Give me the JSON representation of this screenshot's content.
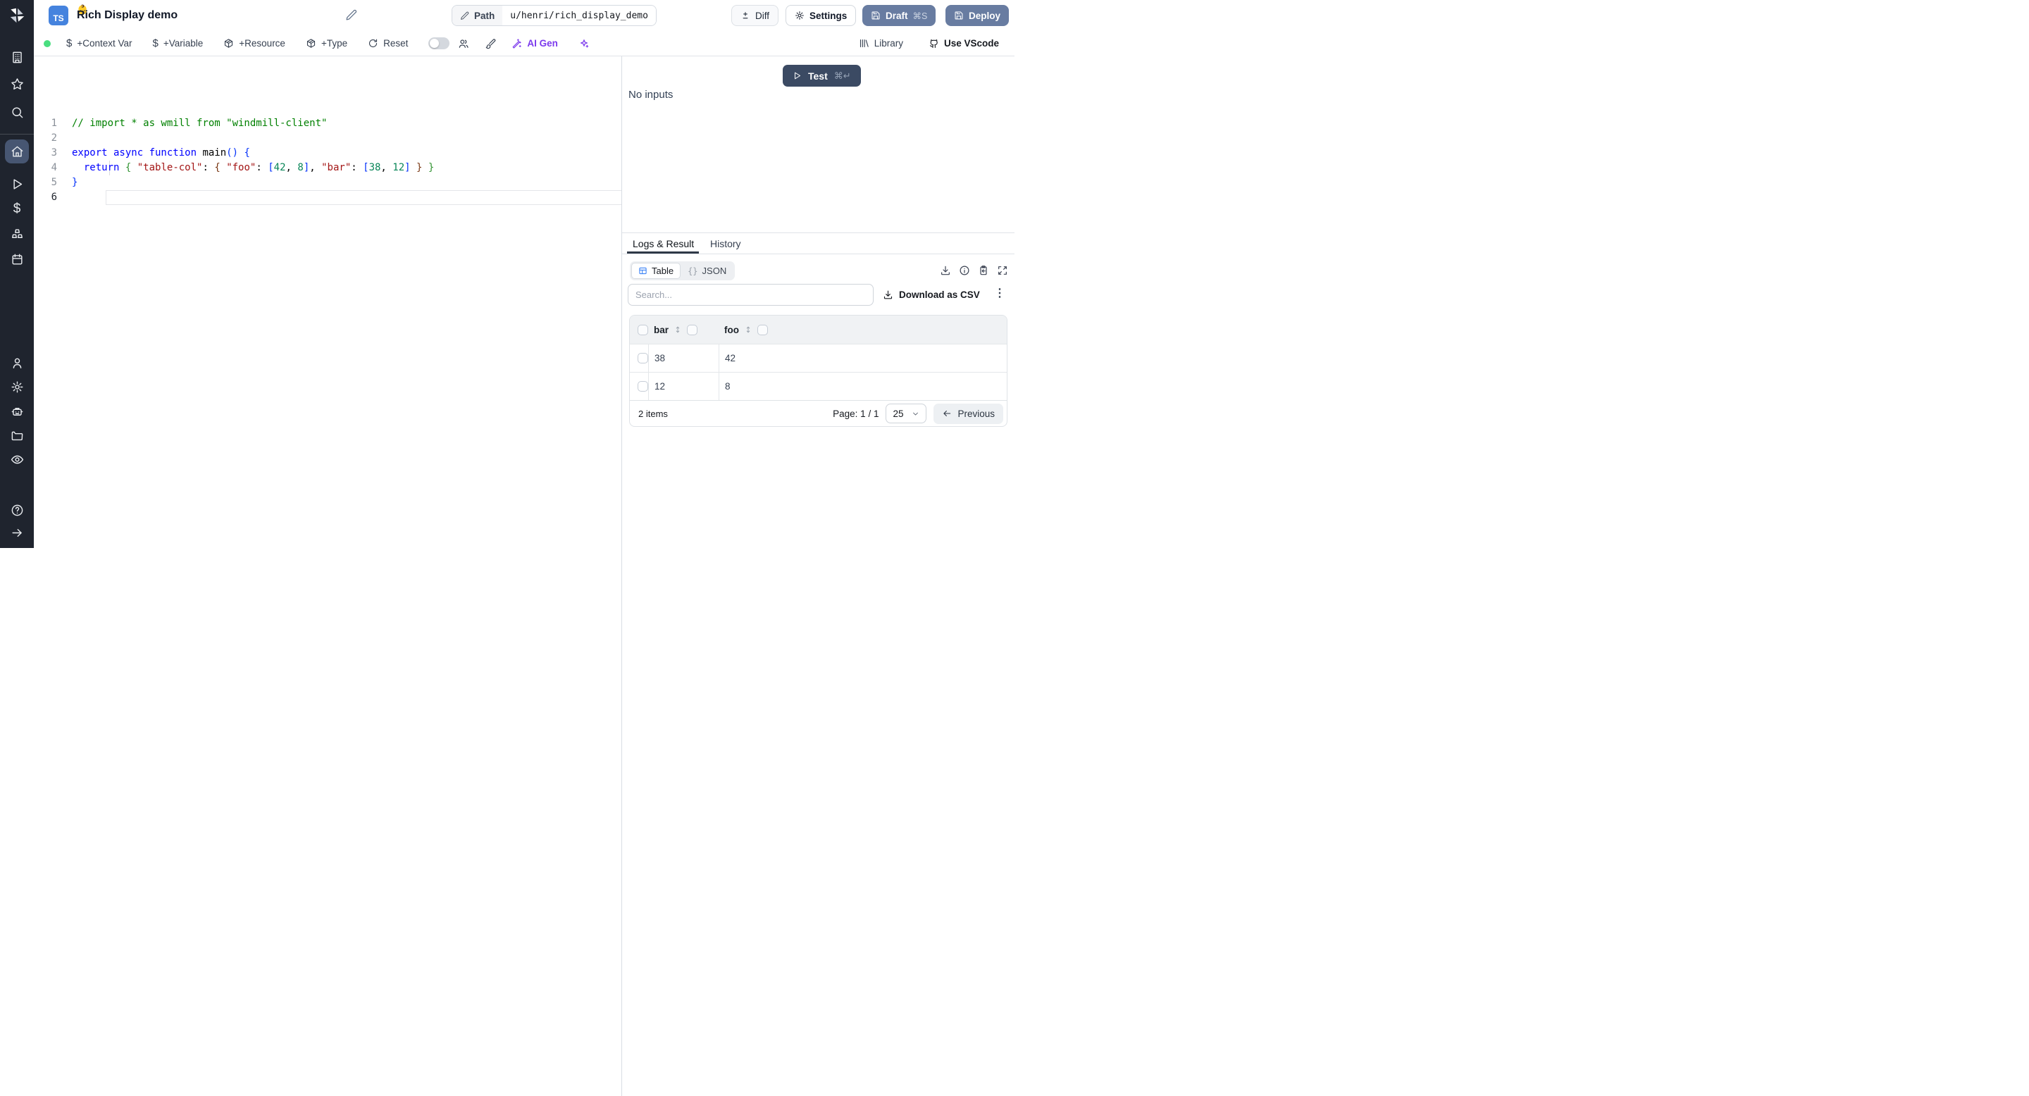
{
  "header": {
    "badge": "TS",
    "emoji": "👶",
    "title": "Rich Display demo",
    "path": {
      "label": "Path",
      "value": "u/henri/rich_display_demo"
    },
    "diff": "Diff",
    "settings": "Settings",
    "draft": "Draft",
    "draft_shortcut": "⌘S",
    "deploy": "Deploy"
  },
  "toolbar": {
    "context_var": "+Context Var",
    "variable": "+Variable",
    "resource": "+Resource",
    "type": "+Type",
    "reset": "Reset",
    "ai_gen": "AI Gen",
    "library": "Library",
    "vscode": "Use VScode",
    "status_color": "#4ade80",
    "ai_color": "#7c3aed"
  },
  "sidebar": {
    "icons": [
      "windmill-logo",
      "building",
      "star",
      "search",
      "home",
      "play",
      "dollar",
      "boxes",
      "calendar",
      "user",
      "gear",
      "robot",
      "folder",
      "eye",
      "help",
      "arrow-right"
    ],
    "active": "home",
    "active_bg": "#475672"
  },
  "editor": {
    "language": "typescript",
    "active_line": 6,
    "lines": [
      {
        "num": 1,
        "tokens": [
          {
            "t": "// import * as wmill from \"windmill-client\"",
            "c": "comment"
          }
        ]
      },
      {
        "num": 2,
        "tokens": []
      },
      {
        "num": 3,
        "tokens": [
          {
            "t": "export async function ",
            "c": "kw"
          },
          {
            "t": "main",
            "c": "plain"
          },
          {
            "t": "()",
            "c": "b1"
          },
          {
            "t": " ",
            "c": "plain"
          },
          {
            "t": "{",
            "c": "b1"
          }
        ]
      },
      {
        "num": 4,
        "tokens": [
          {
            "t": "  ",
            "c": "plain"
          },
          {
            "t": "return",
            "c": "kw"
          },
          {
            "t": " ",
            "c": "plain"
          },
          {
            "t": "{",
            "c": "b2"
          },
          {
            "t": " ",
            "c": "plain"
          },
          {
            "t": "\"table-col\"",
            "c": "str"
          },
          {
            "t": ": ",
            "c": "plain"
          },
          {
            "t": "{",
            "c": "b3"
          },
          {
            "t": " ",
            "c": "plain"
          },
          {
            "t": "\"foo\"",
            "c": "str"
          },
          {
            "t": ": ",
            "c": "plain"
          },
          {
            "t": "[",
            "c": "b1"
          },
          {
            "t": "42",
            "c": "num"
          },
          {
            "t": ", ",
            "c": "plain"
          },
          {
            "t": "8",
            "c": "num"
          },
          {
            "t": "]",
            "c": "b1"
          },
          {
            "t": ", ",
            "c": "plain"
          },
          {
            "t": "\"bar\"",
            "c": "str"
          },
          {
            "t": ": ",
            "c": "plain"
          },
          {
            "t": "[",
            "c": "b1"
          },
          {
            "t": "38",
            "c": "num"
          },
          {
            "t": ", ",
            "c": "plain"
          },
          {
            "t": "12",
            "c": "num"
          },
          {
            "t": "]",
            "c": "b1"
          },
          {
            "t": " ",
            "c": "plain"
          },
          {
            "t": "}",
            "c": "b3"
          },
          {
            "t": " ",
            "c": "plain"
          },
          {
            "t": "}",
            "c": "b2"
          }
        ]
      },
      {
        "num": 5,
        "tokens": [
          {
            "t": "}",
            "c": "b1"
          }
        ]
      },
      {
        "num": 6,
        "tokens": []
      }
    ]
  },
  "preview": {
    "test_label": "Test",
    "test_shortcut": "⌘↵",
    "test_bg": "#3b4a63",
    "no_inputs": "No inputs"
  },
  "results": {
    "tabs": {
      "logs": "Logs & Result",
      "history": "History",
      "active": "Logs & Result"
    },
    "view_toggle": {
      "table": "Table",
      "json": "JSON",
      "json_braces": "{}",
      "active": "Table",
      "table_icon_color": "#3b82f6"
    },
    "search_placeholder": "Search...",
    "download_csv": "Download as CSV",
    "chart_data": {
      "type": "table",
      "columns": [
        "bar",
        "foo"
      ],
      "rows": [
        [
          "38",
          "42"
        ],
        [
          "12",
          "8"
        ]
      ]
    },
    "footer": {
      "items": "2 items",
      "page": "Page: 1 / 1",
      "page_size": "25",
      "previous": "Previous"
    }
  }
}
